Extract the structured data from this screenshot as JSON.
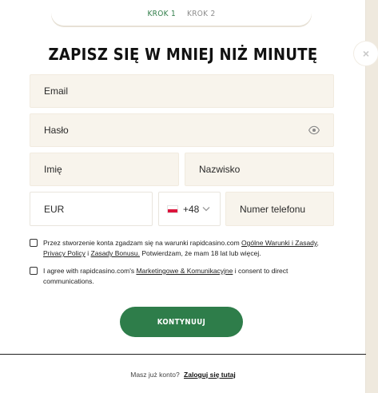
{
  "steps": [
    {
      "label": "KROK 1",
      "active": true
    },
    {
      "label": "KROK 2",
      "active": false
    }
  ],
  "close": {
    "icon": "close-icon",
    "glyph": "×"
  },
  "title": "ZAPISZ SIĘ W MNIEJ NIŻ MINUTĘ",
  "form": {
    "email": {
      "placeholder": "Email"
    },
    "password": {
      "placeholder": "Hasło",
      "icon": "eye-icon"
    },
    "first_name": {
      "placeholder": "Imię"
    },
    "last_name": {
      "placeholder": "Nazwisko"
    },
    "currency": {
      "value": "EUR"
    },
    "dial_code": {
      "value": "+48",
      "flag": "poland-flag-icon"
    },
    "phone": {
      "placeholder": "Numer telefonu"
    }
  },
  "consents": {
    "terms": {
      "text_1": "Przez stworzenie konta zgadzam się na warunki rapidcasino.com ",
      "link_terms": "Ogólne Warunki i Zasady",
      "text_2": ", ",
      "link_privacy": "Privacy Policy",
      "text_3": " i ",
      "link_bonus": "Zasady Bonusu.",
      "text_4": " Potwierdzam, że mam 18 lat lub więcej."
    },
    "marketing": {
      "text_1": "I agree with rapidcasino.com's ",
      "link_marketing": "Marketingowe & Komunikacyjne",
      "text_2": " i consent to direct communications."
    }
  },
  "submit": {
    "label": "KONTYNUUJ"
  },
  "footer": {
    "prompt": "Masz już konto?",
    "login_link": "Zaloguj się tutaj"
  },
  "colors": {
    "accent_green": "#2e7d4a",
    "field_bg": "#f8f4ec",
    "page_bg": "#efe9de",
    "step_active": "#2f7d48",
    "flag_red": "#dc143c"
  }
}
